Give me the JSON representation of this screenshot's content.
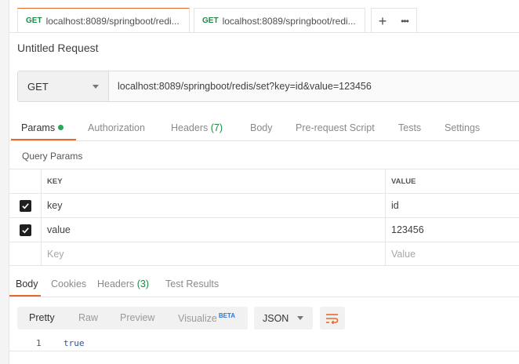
{
  "tabs": [
    {
      "method": "GET",
      "title": "localhost:8089/springboot/redi...",
      "unsaved": true,
      "active": true
    },
    {
      "method": "GET",
      "title": "localhost:8089/springboot/redi...",
      "unsaved": true,
      "active": false
    }
  ],
  "tab_actions": {
    "new_tab": "+",
    "more": "•••"
  },
  "request": {
    "title": "Untitled Request",
    "method": "GET",
    "url": "localhost:8089/springboot/redis/set?key=id&value=123456"
  },
  "request_tabs": [
    {
      "label": "Params"
    },
    {
      "label": "Authorization"
    },
    {
      "label": "Headers",
      "count": "(7)"
    },
    {
      "label": "Body"
    },
    {
      "label": "Pre-request Script"
    },
    {
      "label": "Tests"
    },
    {
      "label": "Settings"
    }
  ],
  "query_params": {
    "title": "Query Params",
    "headers": {
      "key": "KEY",
      "value": "VALUE"
    },
    "rows": [
      {
        "key": "key",
        "value": "id",
        "checked": true
      },
      {
        "key": "value",
        "value": "123456",
        "checked": true
      }
    ],
    "placeholder": {
      "key": "Key",
      "value": "Value"
    }
  },
  "response_tabs": [
    {
      "label": "Body"
    },
    {
      "label": "Cookies"
    },
    {
      "label": "Headers",
      "count": "(3)"
    },
    {
      "label": "Test Results"
    }
  ],
  "response_toolbar": {
    "views": [
      "Pretty",
      "Raw",
      "Preview",
      "Visualize"
    ],
    "beta": "BETA",
    "format": "JSON"
  },
  "response_body": {
    "line_number": "1",
    "content": "true"
  },
  "colors": {
    "accent": "#e36b2c",
    "method_green": "#1b8a46",
    "status_dot": "#27a85b",
    "beta_blue": "#2a7ad8"
  }
}
